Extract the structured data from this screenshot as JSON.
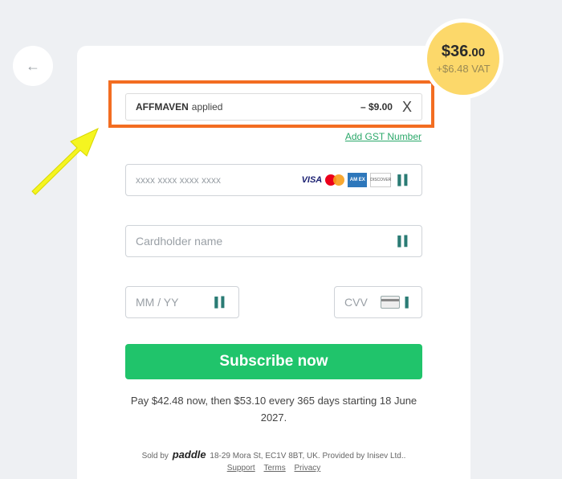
{
  "price": {
    "main": "$36",
    "cents": ".00",
    "vat": "+$6.48 VAT"
  },
  "coupon": {
    "code": "AFFMAVEN",
    "status": "applied",
    "discount": "– $9.00",
    "close_glyph": "X"
  },
  "gst_link": "Add GST Number",
  "fields": {
    "card_number_placeholder": "xxxx xxxx xxxx xxxx",
    "cardholder_placeholder": "Cardholder name",
    "expiry_placeholder": "MM / YY",
    "cvv_placeholder": "CVV"
  },
  "card_brands": {
    "visa": "VISA",
    "amex": "AM EX",
    "discover": "DISCOVER"
  },
  "subscribe_label": "Subscribe now",
  "pay_text": "Pay $42.48 now, then $53.10 every 365 days starting 18 June 2027.",
  "footer": {
    "sold_by": "Sold by",
    "paddle": "paddle",
    "address": "18-29 Mora St, EC1V 8BT, UK.  Provided by  Inisev Ltd..",
    "links": [
      "Support",
      "Terms",
      "Privacy"
    ]
  },
  "colors": {
    "accent_green": "#20c46b",
    "highlight_orange": "#f36d21",
    "badge_yellow": "#fcd86a",
    "arrow_yellow": "#f5f520"
  },
  "icons": {
    "back": "arrow-left-icon",
    "close": "close-icon",
    "password_manager": "password-manager-icon"
  }
}
